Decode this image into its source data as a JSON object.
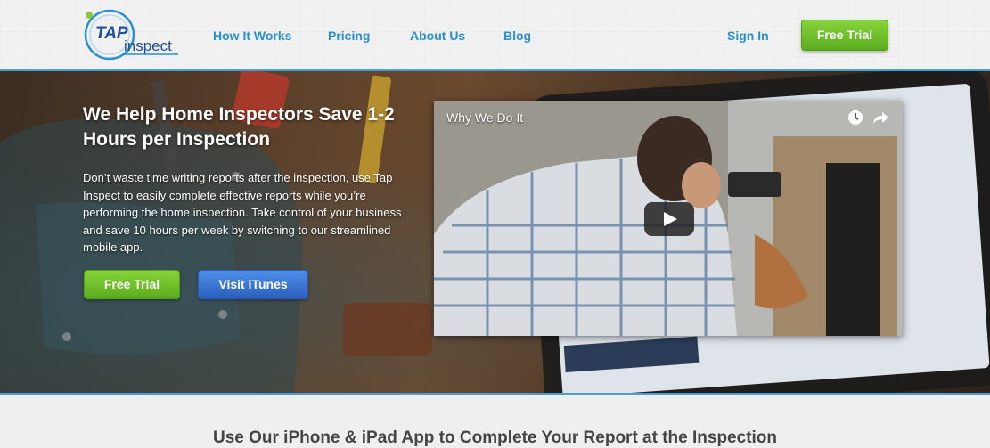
{
  "brand": {
    "logo_tap": "TAP",
    "logo_inspect": "inspect"
  },
  "nav": {
    "items": [
      {
        "label": "How It Works"
      },
      {
        "label": "Pricing"
      },
      {
        "label": "About Us"
      },
      {
        "label": "Blog"
      }
    ],
    "sign_in": "Sign In",
    "free_trial": "Free Trial"
  },
  "hero": {
    "title": "We Help Home Inspectors Save 1-2 Hours per Inspection",
    "text": "Don’t waste time writing reports after the inspection, use Tap Inspect to easily complete effective reports while you’re performing the home inspection. Take control of your business and save 10 hours per week by switching to our streamlined mobile app.",
    "btn_trial": "Free Trial",
    "btn_itunes": "Visit iTunes"
  },
  "video": {
    "title": "Why We Do It",
    "icons": [
      "watch-later-icon",
      "share-icon",
      "play-icon"
    ]
  },
  "section": {
    "heading": "Use Our iPhone & iPad App to Complete Your Report at the Inspection"
  },
  "colors": {
    "accent_blue": "#2a8fd0",
    "accent_green": "#6fc02a",
    "itunes_blue": "#3a72d6",
    "divider": "#4a9fd8"
  }
}
